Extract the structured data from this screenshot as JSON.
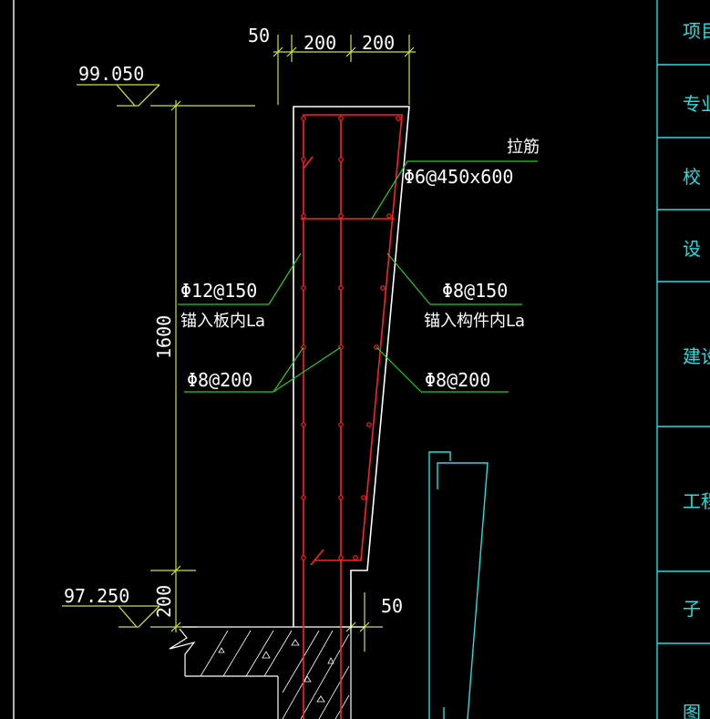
{
  "drawing": {
    "colors": {
      "background": "#000000",
      "dimension": "#c8e632",
      "leader": "#22cc22",
      "outline": "#ffffff",
      "rebar": "#ff2020",
      "title_block": "#20e0e0"
    },
    "elevations": {
      "top": "99.050",
      "bottom": "97.250"
    },
    "dimensions": {
      "offset_50_top": "50",
      "width_200_left": "200",
      "width_200_right": "200",
      "height_1600": "1600",
      "height_200": "200",
      "offset_50_bottom": "50"
    },
    "callouts": {
      "tie_title": "拉筋",
      "tie_spec": "Φ6@450x600",
      "left_main_spec": "Φ12@150",
      "left_main_note": "锚入板内La",
      "right_main_spec": "Φ8@150",
      "right_main_note": "锚入构件内La",
      "left_dist_spec": "Φ8@200",
      "right_dist_spec": "Φ8@200"
    }
  },
  "title_block": {
    "rows": [
      "项目",
      "专业",
      "校",
      "设",
      "建设",
      "工程",
      "子",
      "图"
    ]
  }
}
